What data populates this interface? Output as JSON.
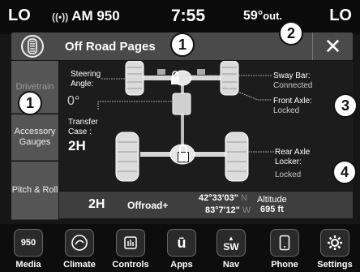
{
  "status": {
    "left_temp": "LO",
    "right_temp": "LO",
    "radio": "AM 950",
    "clock": "7:55",
    "outside_temp": "59°",
    "outside_suffix": "out."
  },
  "header": {
    "title": "Off Road Pages",
    "close_label": "✕"
  },
  "side_tabs": [
    {
      "label": "Drivetrain"
    },
    {
      "label": "Accessory Gauges"
    },
    {
      "label": "Pitch & Roll"
    }
  ],
  "diagram": {
    "steering_label": "Steering Angle:",
    "steering_value": "0°",
    "transfer_label": "Transfer Case :",
    "transfer_value": "2H",
    "sway_label": "Sway Bar:",
    "sway_status": "Connected",
    "front_axle_label": "Front Axle:",
    "front_axle_status": "Locked",
    "rear_axle_label": "Rear Axle Locker:",
    "rear_axle_status": "Locked"
  },
  "info": {
    "mode": "2H",
    "sub_mode": "Offroad+",
    "latitude": "42°33'03\"",
    "lat_dir": "N",
    "longitude": "83°7'12\"",
    "lon_dir": "W",
    "altitude_label": "Altitude",
    "altitude_value": "695 ft"
  },
  "callouts": [
    "1",
    "1",
    "2",
    "3",
    "4"
  ],
  "nav": [
    {
      "label": "Media",
      "icon_text": "950",
      "icon": "radio-icon"
    },
    {
      "label": "Climate",
      "icon_text": "",
      "icon": "climate-icon"
    },
    {
      "label": "Controls",
      "icon_text": "",
      "icon": "controls-icon"
    },
    {
      "label": "Apps",
      "icon_text": "",
      "icon": "apps-icon"
    },
    {
      "label": "Nav",
      "icon_text": "SW",
      "icon": "compass-icon"
    },
    {
      "label": "Phone",
      "icon_text": "",
      "icon": "phone-icon"
    },
    {
      "label": "Settings",
      "icon_text": "",
      "icon": "gear-icon"
    }
  ]
}
